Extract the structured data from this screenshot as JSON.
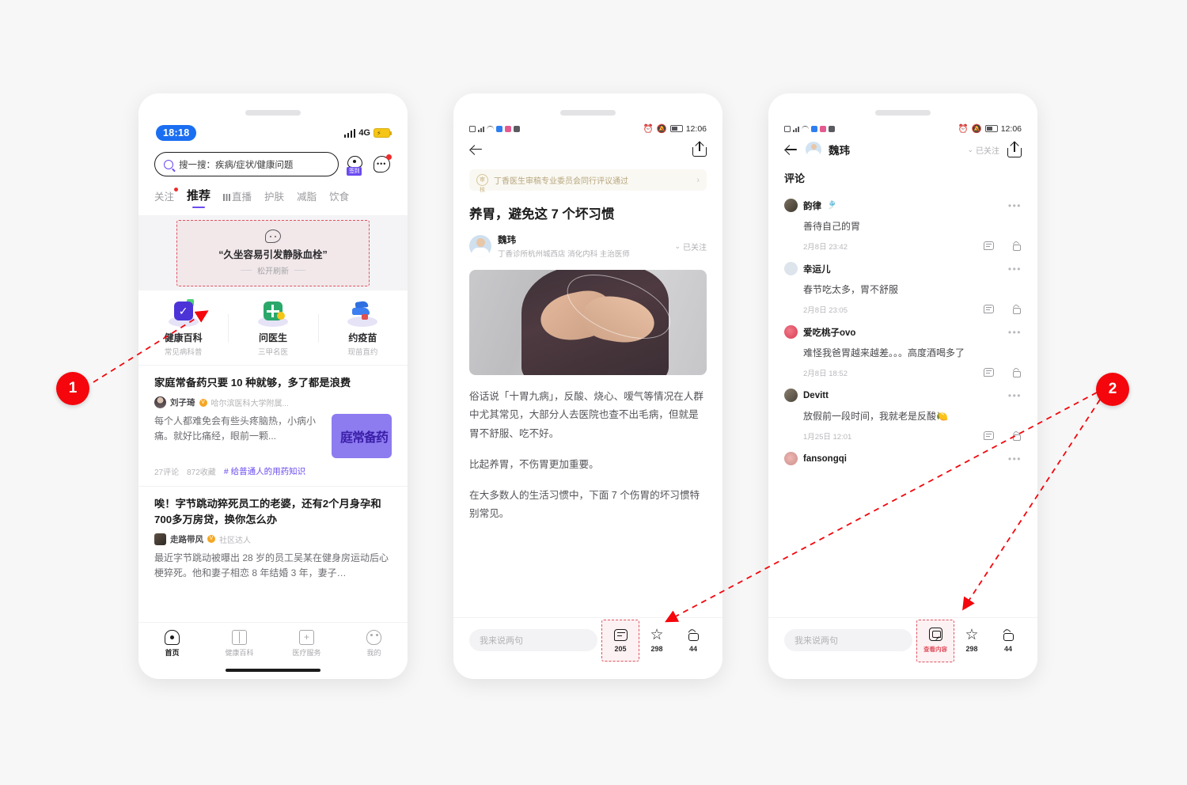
{
  "annotations": [
    {
      "number": "1"
    },
    {
      "number": "2"
    }
  ],
  "phone1": {
    "status": {
      "time": "18:18",
      "network": "4G",
      "battery_icon": "battery-charging-icon"
    },
    "search": {
      "placeholder": "搜一搜：疾病/症状/健康问题",
      "icon": "search-icon"
    },
    "checkin": {
      "label": "签到",
      "icon": "lock-checkin-icon"
    },
    "message": {
      "icon": "message-bubble-icon",
      "has_unread": true
    },
    "tabs": [
      {
        "label": "关注",
        "active": false,
        "dot": true
      },
      {
        "label": "推荐",
        "active": true
      },
      {
        "label": "直播",
        "active": false,
        "icon": "live-bars-icon"
      },
      {
        "label": "护肤",
        "active": false
      },
      {
        "label": "减脂",
        "active": false
      },
      {
        "label": "饮食",
        "active": false
      }
    ],
    "refresh": {
      "icon": "chat-bubble-icon",
      "quote": "“久坐容易引发静脉血栓”",
      "hint": "松开刷新"
    },
    "quick_entries": [
      {
        "title": "健康百科",
        "subtitle": "常见病科普",
        "icon": "checkbox-book-icon"
      },
      {
        "title": "问医生",
        "subtitle": "三甲名医",
        "icon": "medical-kit-icon"
      },
      {
        "title": "约疫苗",
        "subtitle": "现苗直约",
        "icon": "vaccine-icon"
      }
    ],
    "feed": [
      {
        "title": "家庭常备药只要 10 种就够，多了都是浪费",
        "author": "刘子琦",
        "verified": true,
        "org": "哈尔滨医科大学附属...",
        "summary": "每个人都难免会有些头疼脑热，小病小痛。就好比痛经，眼前一颗...",
        "thumb_text": "庭常备药",
        "comments": "27评论",
        "favorites": "872收藏",
        "tag": "# 给普通人的用药知识"
      },
      {
        "title": "唉！字节跳动猝死员工的老婆，还有2个月身孕和700多万房贷，换你怎么办",
        "author": "走路带风",
        "verified": true,
        "org": "社区达人",
        "summary": "最近字节跳动被曝出 28 岁的员工吴某在健身房运动后心梗猝死。他和妻子相恋 8 年结婚 3 年，妻子…"
      }
    ],
    "tabbar": [
      {
        "label": "首页",
        "icon": "home-icon",
        "active": true
      },
      {
        "label": "健康百科",
        "icon": "book-icon",
        "active": false
      },
      {
        "label": "医疗服务",
        "icon": "medical-case-icon",
        "active": false
      },
      {
        "label": "我的",
        "icon": "profile-icon",
        "active": false
      }
    ]
  },
  "phone2": {
    "status": {
      "time": "12:06"
    },
    "nav": {
      "back_icon": "back-arrow-icon",
      "share_icon": "share-icon"
    },
    "verify_bar": {
      "text": "丁香医生审稿专业委员会同行评议通过",
      "seal": "审核",
      "chevron": "›"
    },
    "article": {
      "title": "养胃，避免这 7 个坏习惯",
      "author": "魏玮",
      "author_org": "丁香诊所杭州城西店 消化内科 主治医师",
      "follow_state": "已关注",
      "image_alt": "person-holding-stomach-photo",
      "paragraphs": [
        "俗话说「十胃九病」，反酸、烧心、嗳气等情况在人群中尤其常见，大部分人去医院也查不出毛病，但就是胃不舒服、吃不好。",
        "比起养胃，不伤胃更加重要。",
        "在大多数人的生活习惯中，下面 7 个伤胃的坏习惯特别常见。"
      ]
    },
    "bottombar": {
      "input_placeholder": "我来说两句",
      "comment_count": "205",
      "star_count": "298",
      "like_count": "44"
    }
  },
  "phone3": {
    "status": {
      "time": "12:06"
    },
    "nav": {
      "back_icon": "back-arrow-icon",
      "author": "魏玮",
      "follow_state": "已关注",
      "share_icon": "share-icon"
    },
    "section_title": "评论",
    "comments": [
      {
        "name": "韵律",
        "emoji": "🎐",
        "text": "善待自己的胃",
        "date": "2月8日 23:42"
      },
      {
        "name": "幸运儿",
        "emoji": "",
        "text": "春节吃太多，胃不舒服",
        "date": "2月8日 23:05"
      },
      {
        "name": "爱吃桃子ovo",
        "emoji": "",
        "text": "难怪我爸胃越来越差。。。高度酒喝多了",
        "date": "2月8日 18:52"
      },
      {
        "name": "Devitt",
        "emoji": "",
        "text": "放假前一段时间，我就老是反酸🍋",
        "date": "1月25日 12:01"
      },
      {
        "name": "fansongqi",
        "emoji": "",
        "text": "",
        "date": ""
      }
    ],
    "bottombar": {
      "input_placeholder": "我来说两句",
      "view_content_label": "查看内容",
      "star_count": "298",
      "like_count": "44"
    }
  },
  "colors": {
    "accent_purple": "#6b4bf0",
    "marker_red": "#f4060c",
    "highlight_red": "#e0515f",
    "status_blue": "#1a6ef2"
  }
}
